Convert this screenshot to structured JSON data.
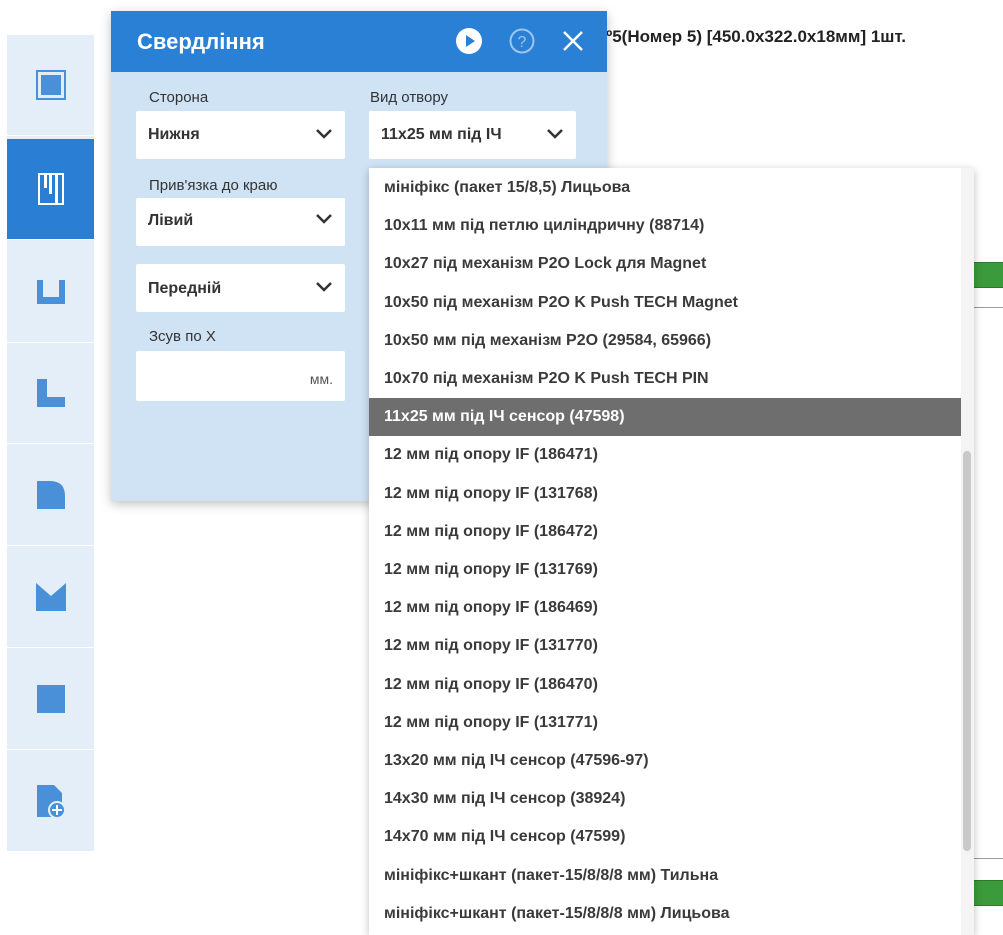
{
  "header": {
    "part_info": "º5(Номер 5) [450.0x322.0x18мм] 1шт."
  },
  "toolbar": {
    "items": [
      {
        "icon": "square-frame-icon",
        "active": false
      },
      {
        "icon": "drilling-icon",
        "active": true
      },
      {
        "icon": "u-groove-icon",
        "active": false
      },
      {
        "icon": "corner-cut-icon",
        "active": false
      },
      {
        "icon": "rounded-corner-icon",
        "active": false
      },
      {
        "icon": "v-cut-icon",
        "active": false
      },
      {
        "icon": "rectangle-icon",
        "active": false
      },
      {
        "icon": "add-file-icon",
        "active": false
      }
    ]
  },
  "panel": {
    "title": "Свердління",
    "side_label": "Сторона",
    "side_value": "Нижня",
    "hole_type_label": "Вид отвору",
    "hole_type_value": "11x25 мм під ІЧ",
    "edge_label": "Прив'язка до краю",
    "edge_value": "Лівий",
    "edge_second_value": "Передній",
    "offset_x_label": "Зсув по X",
    "offset_x_value": "",
    "offset_unit": "мм."
  },
  "dropdown": {
    "options": [
      "мініфікс (пакет 15/8,5) Лицьова",
      "10x11 мм під петлю циліндричну (88714)",
      "10x27 під механізм P2O Lock для Magnet",
      "10x50 під механізм P2O K Push TECH Magnet",
      "10x50 мм під механізм P2O (29584, 65966)",
      "10x70 під механізм P2O K Push TECH PIN",
      "11x25 мм під ІЧ сенсор (47598)",
      "12 мм під опору IF (186471)",
      "12 мм під опору IF (131768)",
      "12 мм під опору IF (186472)",
      "12 мм під опору IF (131769)",
      "12 мм під опору IF (186469)",
      "12 мм під опору IF (131770)",
      "12 мм під опору IF (186470)",
      "12 мм під опору IF (131771)",
      "13x20 мм під ІЧ сенсор (47596-97)",
      "14x30 мм під ІЧ сенсор (38924)",
      "14x70 мм під ІЧ сенсор (47599)",
      "мініфікс+шкант (пакет-15/8/8/8 мм) Тильна",
      "мініфікс+шкант (пакет-15/8/8/8 мм) Лицьова"
    ],
    "selected_index": 6
  },
  "colors": {
    "accent": "#2a80d5",
    "panel_bg": "#cfe3f5",
    "toolbar_bg": "#e4eef8",
    "selected_bg": "#6e6e6e",
    "green": "#3b9a3b"
  }
}
